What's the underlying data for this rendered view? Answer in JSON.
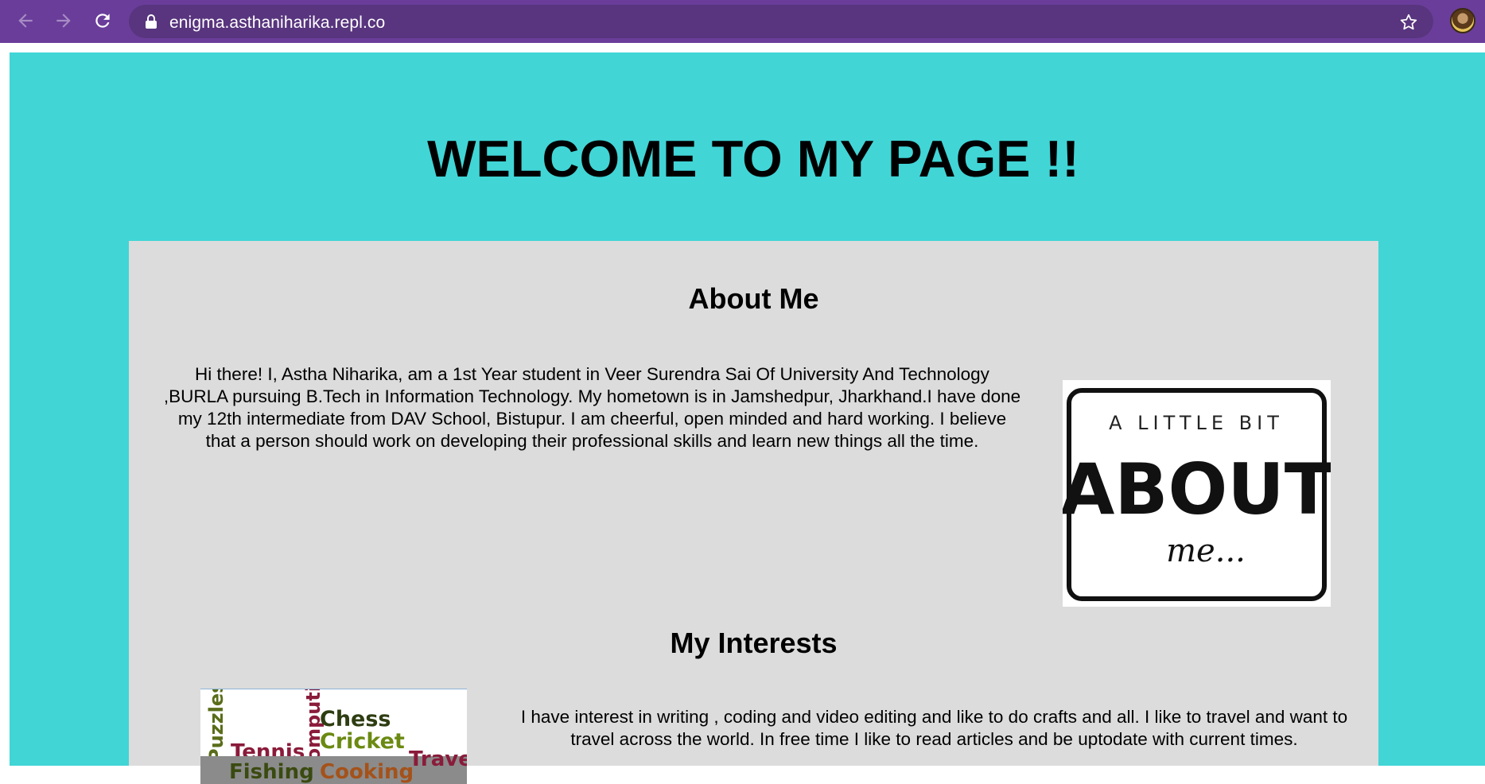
{
  "browser": {
    "url": "enigma.asthaniharika.repl.co",
    "back_icon": "arrow-left-icon",
    "forward_icon": "arrow-right-icon",
    "reload_icon": "reload-icon",
    "lock_icon": "lock-icon",
    "bookmark_icon": "star-icon",
    "chrome_color": "#6a3d9a"
  },
  "page": {
    "title": "WELCOME TO MY PAGE !!",
    "background": "#41d5d6",
    "card_background": "#dcdcdc"
  },
  "about": {
    "heading": "About Me",
    "text": "Hi there! I, Astha Niharika, am a 1st Year student in Veer Surendra Sai Of University And Technology ,BURLA pursuing B.Tech in Information Technology. My hometown is in Jamshedpur, Jharkhand.I have done my 12th intermediate from DAV School, Bistupur. I am cheerful, open minded and hard working. I believe that a person should work on developing their professional skills and learn new things all the time.",
    "image_text": {
      "line1": "A LITTLE BIT",
      "line2": "ABOUT",
      "line3": "me..."
    }
  },
  "interests": {
    "heading": "My Interests",
    "text": "I have interest in writing , coding and video editing and like to do crafts and all. I like to travel and want to travel across the world. In free time I like to read articles and be uptodate with current times.",
    "image_words": [
      "Puzzles",
      "Tennis",
      "Computing",
      "Chess",
      "Cricket",
      "Fishing",
      "Cooking",
      "Travel"
    ]
  }
}
